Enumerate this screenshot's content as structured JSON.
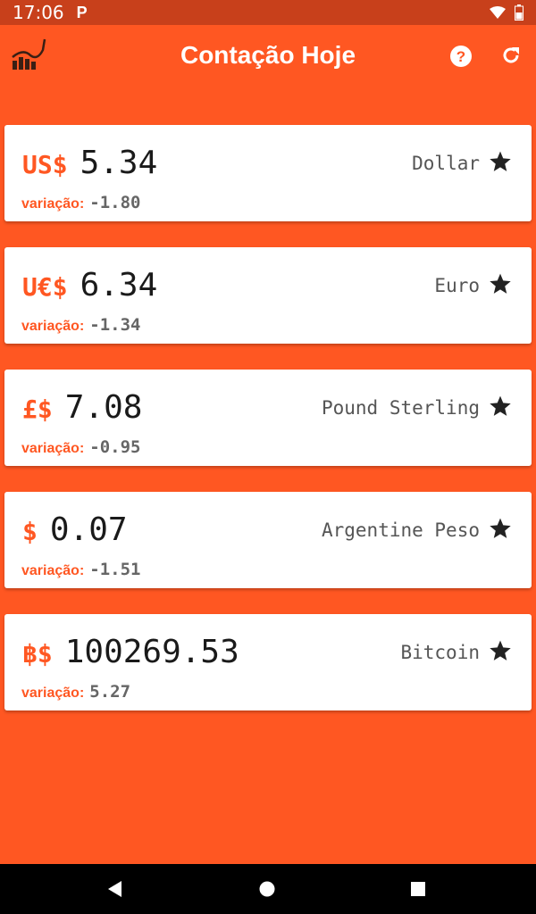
{
  "status_bar": {
    "time": "17:06",
    "app_indicator": "P",
    "icons": [
      "wifi-icon",
      "battery-icon"
    ]
  },
  "app_bar": {
    "title": "Contação Hoje",
    "logo_icon": "chart-logo-icon",
    "actions": [
      "help-icon",
      "refresh-icon"
    ]
  },
  "variation_label": "variação:",
  "currencies": [
    {
      "symbol": "US$",
      "value": "5.34",
      "name": "Dollar",
      "variation": "-1.80"
    },
    {
      "symbol": "U€$",
      "value": "6.34",
      "name": "Euro",
      "variation": "-1.34"
    },
    {
      "symbol": "£$",
      "value": "7.08",
      "name": "Pound Sterling",
      "variation": "-0.95"
    },
    {
      "symbol": "$",
      "value": "0.07",
      "name": "Argentine Peso",
      "variation": "-1.51"
    },
    {
      "symbol": "฿$",
      "value": "100269.53",
      "name": "Bitcoin",
      "variation": "5.27"
    }
  ],
  "colors": {
    "primary": "#FF5722",
    "status_bar": "#C8401B",
    "card": "#FFFFFF",
    "nav_bar": "#000000"
  },
  "nav_bar": [
    "back-icon",
    "home-icon",
    "recents-icon"
  ]
}
